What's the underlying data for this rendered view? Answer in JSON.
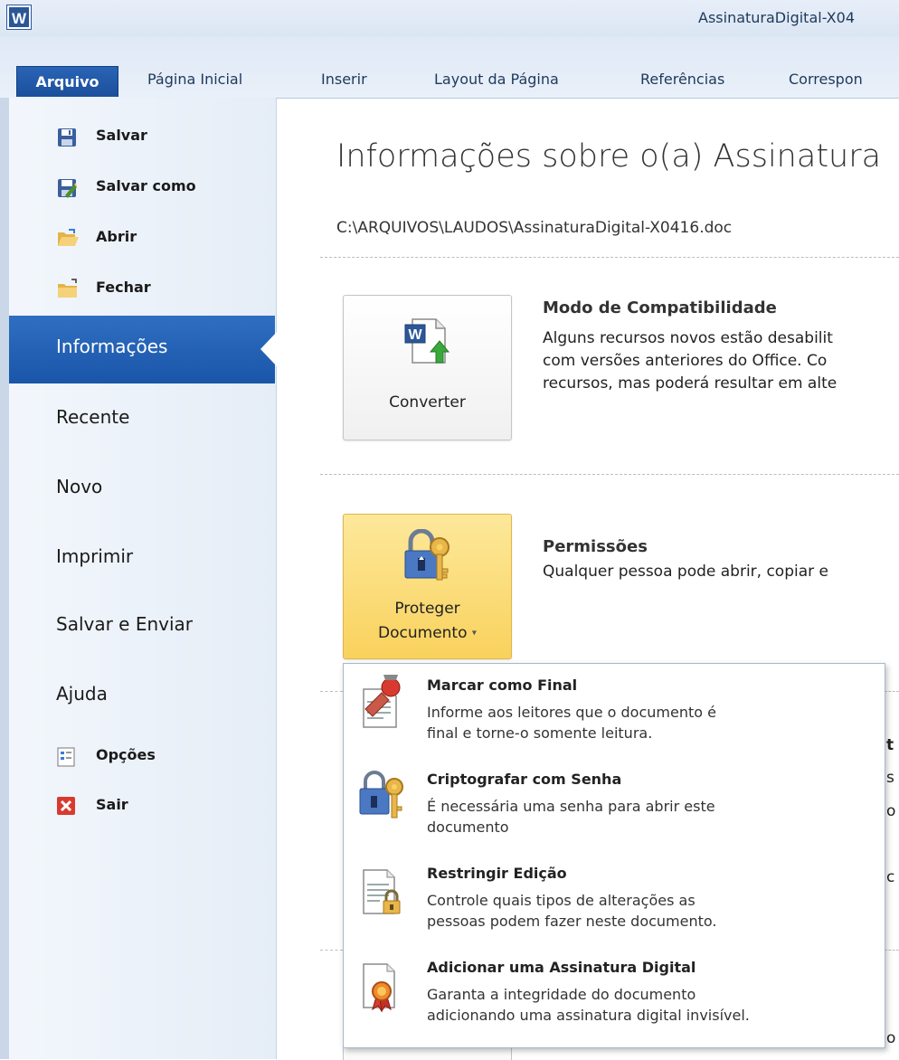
{
  "window": {
    "title": "AssinaturaDigital-X04",
    "app_icon": "W"
  },
  "ribbon": {
    "tabs": [
      "Arquivo",
      "Página Inicial",
      "Inserir",
      "Layout da Página",
      "Referências",
      "Correspon"
    ]
  },
  "sidebar": {
    "commands": [
      {
        "label": "Salvar",
        "icon": "save-icon"
      },
      {
        "label": "Salvar como",
        "icon": "save-as-icon"
      },
      {
        "label": "Abrir",
        "icon": "open-folder-icon"
      },
      {
        "label": "Fechar",
        "icon": "close-folder-icon"
      }
    ],
    "active": "Informações",
    "items": [
      "Recente",
      "Novo",
      "Imprimir",
      "Salvar e Enviar",
      "Ajuda"
    ],
    "bottom": [
      {
        "label": "Opções",
        "icon": "options-icon"
      },
      {
        "label": "Sair",
        "icon": "exit-icon"
      }
    ]
  },
  "main": {
    "title": "Informações sobre o(a) Assinatura",
    "path": "C:\\ARQUIVOS\\LAUDOS\\AssinaturaDigital-X0416.doc",
    "compat": {
      "button_label": "Converter",
      "heading": "Modo de Compatibilidade",
      "lines": [
        "Alguns recursos novos estão desabilit",
        "com versões anteriores do Office. Co",
        "recursos, mas poderá resultar em alte"
      ]
    },
    "permissions": {
      "button_line1": "Proteger",
      "button_line2": "Documento",
      "heading": "Permissões",
      "text": "Qualquer pessoa pode abrir, copiar e"
    },
    "partials": [
      "t",
      "s",
      "o",
      "c",
      "o"
    ]
  },
  "dropdown": {
    "items": [
      {
        "title": "Marcar como Final",
        "desc": [
          "Informe aos leitores que o documento é",
          "final e torne-o somente leitura."
        ],
        "icon": "mark-final-icon"
      },
      {
        "title": "Criptografar com Senha",
        "desc": [
          "É necessária uma senha para abrir este",
          "documento"
        ],
        "icon": "encrypt-lock-icon"
      },
      {
        "title": "Restringir Edição",
        "desc": [
          "Controle quais tipos de alterações as",
          "pessoas podem fazer neste documento."
        ],
        "icon": "restrict-editing-icon"
      },
      {
        "title": "Adicionar uma Assinatura Digital",
        "desc": [
          "Garanta a integridade do documento",
          "adicionando uma assinatura digital invisível."
        ],
        "icon": "digital-signature-icon"
      }
    ]
  },
  "colors": {
    "accent": "#1b5aa8",
    "button_highlight": "#f9d25d"
  }
}
